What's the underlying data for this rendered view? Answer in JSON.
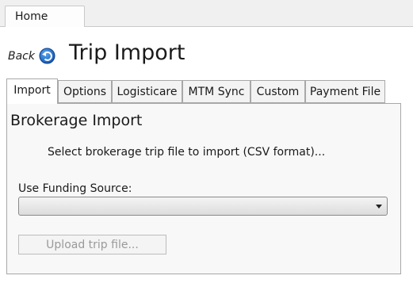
{
  "window": {
    "tabs": [
      {
        "label": "Home"
      }
    ]
  },
  "header": {
    "back_label": "Back",
    "back_icon": "back-arrow-icon",
    "title": "Trip Import"
  },
  "tabs": [
    {
      "label": "Import",
      "active": true
    },
    {
      "label": "Options"
    },
    {
      "label": "Logisticare"
    },
    {
      "label": "MTM Sync"
    },
    {
      "label": "Custom"
    },
    {
      "label": "Payment File"
    }
  ],
  "panel": {
    "title": "Brokerage Import",
    "instruction": "Select brokerage trip file to import (CSV format)...",
    "funding_label": "Use Funding Source:",
    "funding_value": "",
    "upload_label": "Upload trip file..."
  },
  "colors": {
    "back_icon_blue": "#1565c0",
    "border": "#a8a8a8",
    "disabled_text": "#9a9a9a"
  }
}
